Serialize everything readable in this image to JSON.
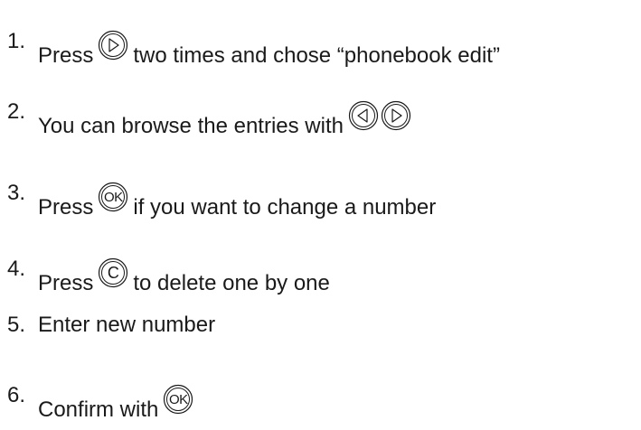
{
  "steps": [
    {
      "number": "1.",
      "before": "Press",
      "after": "two times and chose “phonebook edit”"
    },
    {
      "number": "2.",
      "before": "You can browse the entries with",
      "after": ""
    },
    {
      "number": "3.",
      "before": "Press",
      "after": "if you want to change a number"
    },
    {
      "number": "4.",
      "before": "Press",
      "after": "to delete one by one"
    },
    {
      "number": "5.",
      "before": "Enter new number",
      "after": ""
    },
    {
      "number": "6.",
      "before": "Confirm with",
      "after": ""
    }
  ],
  "keys": {
    "ok": "OK",
    "c": "C"
  }
}
